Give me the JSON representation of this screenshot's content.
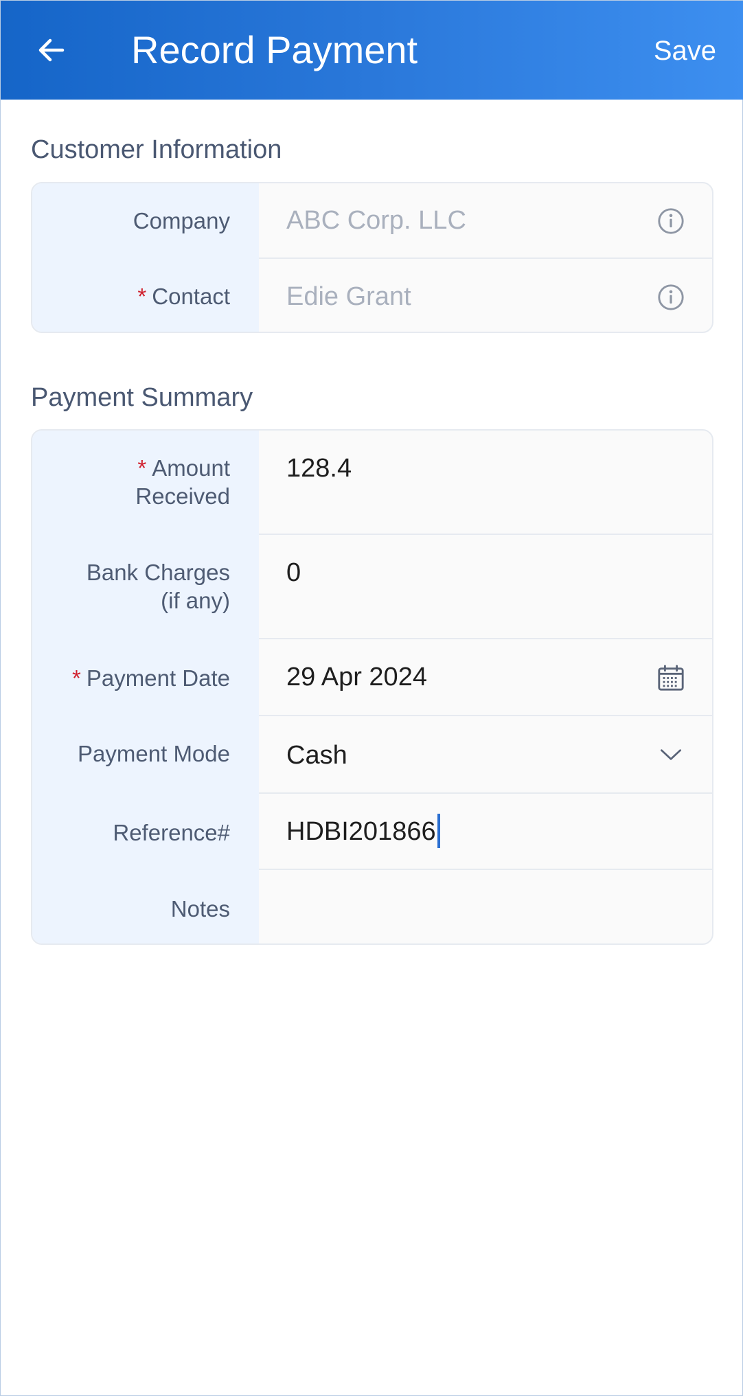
{
  "app_bar": {
    "title": "Record Payment",
    "save_label": "Save",
    "back_icon": "arrow-left-icon",
    "background_start": "#1565c8",
    "background_end": "#3d8ff0"
  },
  "customer_info": {
    "section_title": "Customer Information",
    "fields": [
      {
        "label": "Company",
        "required": false,
        "value": "ABC Corp. LLC",
        "icon": "info-icon"
      },
      {
        "label": "Contact",
        "required": true,
        "value": "Edie Grant",
        "icon": "info-icon"
      }
    ]
  },
  "payment_summary": {
    "section_title": "Payment Summary",
    "fields": [
      {
        "label_line1": "Amount",
        "label_line2": "Received",
        "required": true,
        "value": "128.4"
      },
      {
        "label_line1": "Bank Charges",
        "label_line2": "(if any)",
        "required": false,
        "value": "0"
      },
      {
        "label": "Payment Date",
        "required": true,
        "value": "29 Apr 2024",
        "icon": "calendar-icon"
      },
      {
        "label": "Payment Mode",
        "required": false,
        "value": "Cash",
        "icon": "chevron-down-icon"
      },
      {
        "label": "Reference#",
        "required": false,
        "value": "HDBI201866"
      },
      {
        "label": "Notes",
        "required": false,
        "value": ""
      }
    ]
  },
  "required_marker": "*",
  "colors": {
    "label_column_bg": "#edf4fe",
    "required": "#d0202e",
    "cursor": "#2b6fd1"
  }
}
